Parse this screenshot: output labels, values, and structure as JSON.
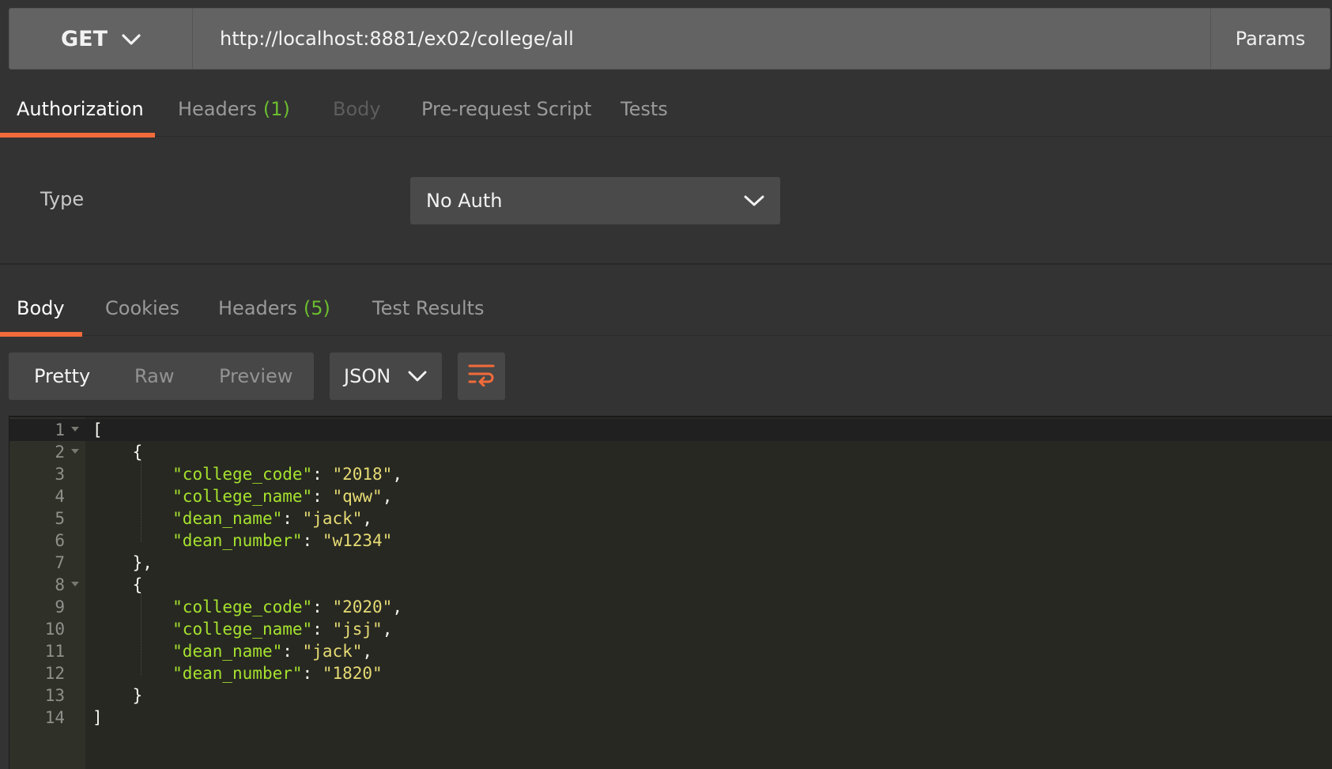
{
  "request": {
    "method": "GET",
    "url": "http://localhost:8881/ex02/college/all",
    "params_label": "Params"
  },
  "request_tabs": [
    {
      "label": "Authorization"
    },
    {
      "label": "Headers",
      "count": "(1)"
    },
    {
      "label": "Body"
    },
    {
      "label": "Pre-request Script"
    },
    {
      "label": "Tests"
    }
  ],
  "authorization": {
    "type_label": "Type",
    "type_value": "No Auth"
  },
  "response_tabs": [
    {
      "label": "Body"
    },
    {
      "label": "Cookies"
    },
    {
      "label": "Headers",
      "count": "(5)"
    },
    {
      "label": "Test Results"
    }
  ],
  "view_modes": [
    "Pretty",
    "Raw",
    "Preview"
  ],
  "format": "JSON",
  "code_lines": [
    {
      "num": "1",
      "open": "[",
      "k": "",
      "mid": "",
      "v": "",
      "close": ""
    },
    {
      "num": "2",
      "open": "    {",
      "k": "",
      "mid": "",
      "v": "",
      "close": ""
    },
    {
      "num": "3",
      "open": "        ",
      "k": "\"college_code\"",
      "mid": ": ",
      "v": "\"2018\"",
      "close": ","
    },
    {
      "num": "4",
      "open": "        ",
      "k": "\"college_name\"",
      "mid": ": ",
      "v": "\"qww\"",
      "close": ","
    },
    {
      "num": "5",
      "open": "        ",
      "k": "\"dean_name\"",
      "mid": ": ",
      "v": "\"jack\"",
      "close": ","
    },
    {
      "num": "6",
      "open": "        ",
      "k": "\"dean_number\"",
      "mid": ": ",
      "v": "\"w1234\"",
      "close": ""
    },
    {
      "num": "7",
      "open": "    },",
      "k": "",
      "mid": "",
      "v": "",
      "close": ""
    },
    {
      "num": "8",
      "open": "    {",
      "k": "",
      "mid": "",
      "v": "",
      "close": ""
    },
    {
      "num": "9",
      "open": "        ",
      "k": "\"college_code\"",
      "mid": ": ",
      "v": "\"2020\"",
      "close": ","
    },
    {
      "num": "10",
      "open": "        ",
      "k": "\"college_name\"",
      "mid": ": ",
      "v": "\"jsj\"",
      "close": ","
    },
    {
      "num": "11",
      "open": "        ",
      "k": "\"dean_name\"",
      "mid": ": ",
      "v": "\"jack\"",
      "close": ","
    },
    {
      "num": "12",
      "open": "        ",
      "k": "\"dean_number\"",
      "mid": ": ",
      "v": "\"1820\"",
      "close": ""
    },
    {
      "num": "13",
      "open": "    }",
      "k": "",
      "mid": "",
      "v": "",
      "close": ""
    },
    {
      "num": "14",
      "open": "]",
      "k": "",
      "mid": "",
      "v": "",
      "close": ""
    }
  ],
  "colors": {
    "accent": "#f26b3a",
    "count": "#6bbd2f",
    "json_key": "#a6e22e",
    "json_string": "#e6db74"
  }
}
